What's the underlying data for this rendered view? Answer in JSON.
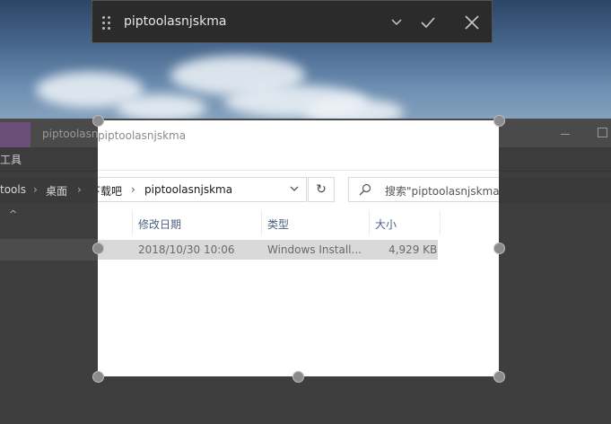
{
  "topbar": {
    "title": "piptoolasnjskma",
    "icons": [
      "drag-handle-icon",
      "chevron-down-icon",
      "checkmark-icon",
      "close-icon"
    ]
  },
  "background_window": {
    "title": "piptoolasnjskma",
    "ribbon_label": "工具",
    "breadcrumb": [
      "tools",
      "桌面",
      "下载吧",
      "piptoolasnjskma"
    ]
  },
  "capture": {
    "title": "piptoolasnjskma",
    "address": {
      "crumbs": [
        "下载吧",
        "piptoolasnjskma"
      ]
    },
    "search": {
      "text": "搜索\"piptoolasnjskma\""
    },
    "columns": [
      "修改日期",
      "类型",
      "大小"
    ],
    "rows": [
      {
        "modified": "2018/10/30 10:06",
        "type": "Windows Install...",
        "size": "4,929 KB"
      }
    ]
  }
}
